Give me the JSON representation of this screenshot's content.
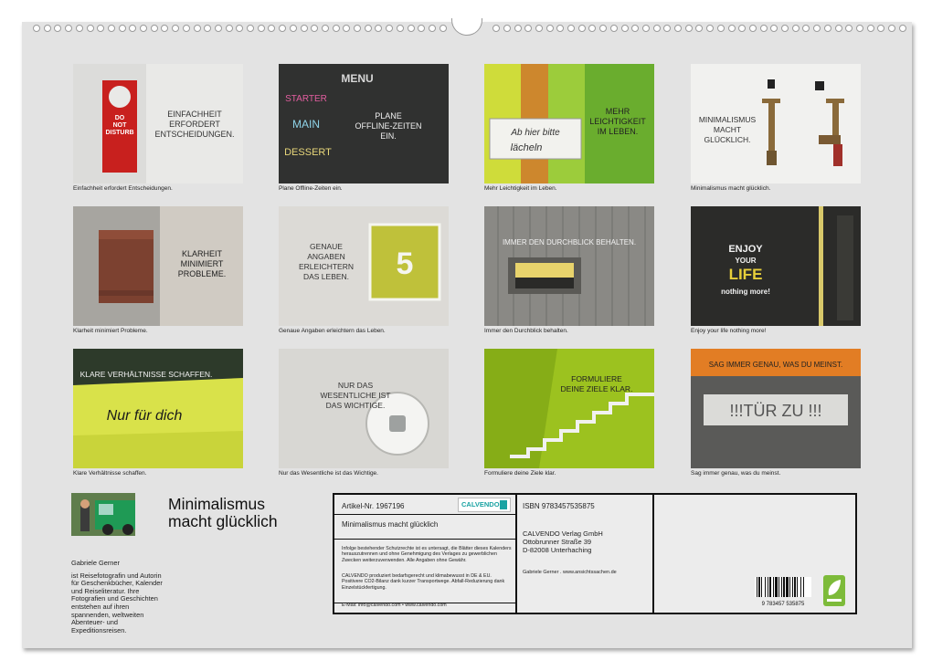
{
  "calendar": {
    "title_line1": "Minimalismus",
    "title_line2": "macht glücklich"
  },
  "thumbnails": [
    {
      "text": [
        "EINFACHHEIT",
        "ERFORDERT",
        "ENTSCHEIDUNGEN."
      ],
      "sign": [
        "DO",
        "NOT",
        "DISTURB"
      ],
      "caption": "Einfachheit erfordert Entscheidungen."
    },
    {
      "text": [
        "PLANE",
        "OFFLINE-ZEITEN",
        "EIN."
      ],
      "board": [
        "MENU",
        "STARTER",
        "MAIN",
        "DESSERT"
      ],
      "caption": "Plane Offline-Zeiten ein."
    },
    {
      "text": [
        "MEHR",
        "LEICHTIGKEIT",
        "IM LEBEN."
      ],
      "sign": [
        "Ab hier bitte",
        "lächeln"
      ],
      "caption": "Mehr Leichtigkeit im Leben."
    },
    {
      "text": [
        "MINIMALISMUS",
        "MACHT",
        "GLÜCKLICH."
      ],
      "caption": "Minimalismus macht glücklich."
    },
    {
      "text": [
        "KLARHEIT",
        "MINIMIERT",
        "PROBLEME."
      ],
      "caption": "Klarheit minimiert Probleme."
    },
    {
      "text": [
        "GENAUE",
        "ANGABEN",
        "ERLEICHTERN",
        "DAS LEBEN."
      ],
      "number": "5",
      "caption": "Genaue Angaben erleichtern das Leben."
    },
    {
      "text": [
        "IMMER DEN DURCHBLICK BEHALTEN."
      ],
      "caption": "Immer den Durchblick behalten."
    },
    {
      "text": [
        "ENJOY",
        "YOUR",
        "LIFE",
        "nothing more!"
      ],
      "caption": "Enjoy your life nothing more!"
    },
    {
      "text": [
        "KLARE VERHÄLTNISSE SCHAFFEN."
      ],
      "graffiti": "Nur für dich",
      "caption": "Klare Verhältnisse schaffen."
    },
    {
      "text": [
        "NUR DAS",
        "WESENTLICHE IST",
        "DAS WICHTIGE."
      ],
      "caption": "Nur das Wesentliche ist das Wichtige."
    },
    {
      "text": [
        "FORMULIERE",
        "DEINE ZIELE KLAR."
      ],
      "caption": "Formuliere deine Ziele klar."
    },
    {
      "text": [
        "SAG IMMER GENAU, WAS DU MEINST."
      ],
      "sign": "!!!TÜR ZU !!!",
      "caption": "Sag immer genau, was du meinst."
    }
  ],
  "author": {
    "name": "Gabriele Gerner",
    "bio": "ist Reisefotografin und Autorin für Geschenkbücher, Kalender und Reiseliteratur. Ihre Fotografien und Geschichten entstehen auf ihren spannenden, weltweiten Abenteuer- und Expeditionsreisen."
  },
  "info": {
    "article_no": "Artikel-Nr. 1967196",
    "brand": "CALVENDO",
    "product_title": "Minimalismus macht glücklich",
    "copyright": "Infolge bestehender Schutzrechte ist es untersagt, die Blätter dieses Kalenders herauszutrennen und ohne Genehmigung des Verlages zu gewerblichen Zwecken weiterzuverwenden. Alle Angaben ohne Gewähr.",
    "climate": "CALVENDO produziert bedarfsgerecht und klimabewusst in DE & EU. Positivere CO2-Bilanz dank kurzer Transportwege. Abfall-Reduzierung dank Einzelstückfertigung.",
    "email": "E-Mail: info@calvendo.com • www.calvendo.com",
    "isbn": "ISBN 9783457535875",
    "publisher_name": "CALVENDO Verlag GmbH",
    "publisher_street": "Ottobrunner Straße 39",
    "publisher_city": "D-82008 Unterhaching",
    "author_link": "Gabriele Gerner . www.ansichtssachen.de",
    "barcode_digits": "9 783457 535875"
  },
  "colors": {
    "page": "#e3e3e3",
    "calvendo_teal": "#1aa3a3",
    "eco_green": "#7dbb3a",
    "sign_red": "#c8201e",
    "lime": "#9cc21f"
  }
}
